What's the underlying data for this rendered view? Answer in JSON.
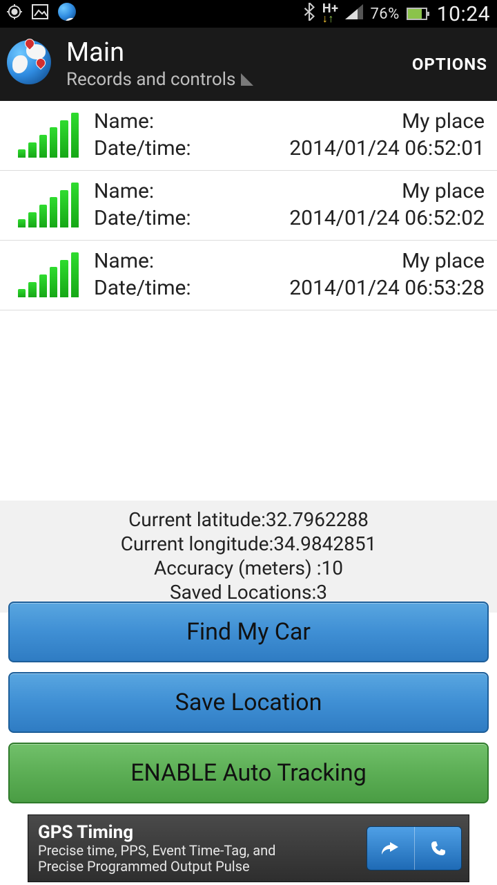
{
  "status_bar": {
    "battery_pct": "76%",
    "clock": "10:24",
    "network_label": "H+"
  },
  "action_bar": {
    "title": "Main",
    "subtitle": "Records and controls",
    "options_label": "OPTIONS"
  },
  "labels": {
    "name": "Name:",
    "datetime": "Date/time:"
  },
  "records": [
    {
      "name": "My place",
      "datetime": "2014/01/24 06:52:01"
    },
    {
      "name": "My place",
      "datetime": "2014/01/24 06:52:02"
    },
    {
      "name": "My place",
      "datetime": "2014/01/24 06:53:28"
    }
  ],
  "info": {
    "lat_label": "Current latitude:",
    "lat_value": "32.7962288",
    "lon_label": "Current longitude:",
    "lon_value": "34.9842851",
    "acc_label": "Accuracy (meters) :",
    "acc_value": "10",
    "saved_label": "Saved Locations:",
    "saved_value": "3"
  },
  "buttons": {
    "find": "Find My Car",
    "save": "Save Location",
    "enable": "ENABLE Auto Tracking"
  },
  "ad": {
    "title": "GPS Timing",
    "line1": "Precise time, PPS, Event Time-Tag, and",
    "line2": "Precise Programmed Output Pulse"
  }
}
